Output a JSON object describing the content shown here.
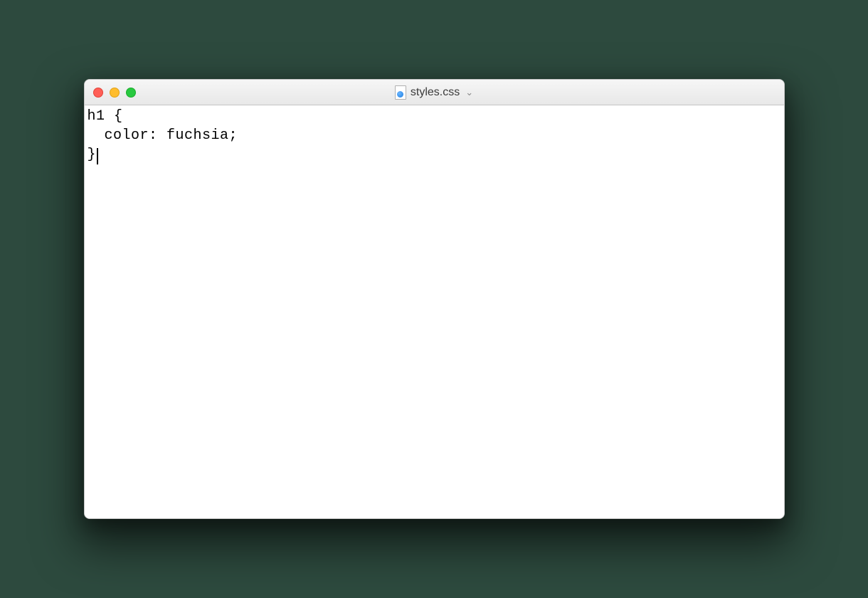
{
  "window": {
    "title": "styles.css"
  },
  "editor": {
    "line1": "h1 {",
    "line2_indented": "color: fuchsia;",
    "line3": "}"
  },
  "icons": {
    "file": "css-file-icon",
    "chevron": "chevron-down-icon"
  },
  "colors": {
    "traffic_red": "#ff5f57",
    "traffic_yellow": "#ffbd2e",
    "traffic_green": "#28c940"
  }
}
